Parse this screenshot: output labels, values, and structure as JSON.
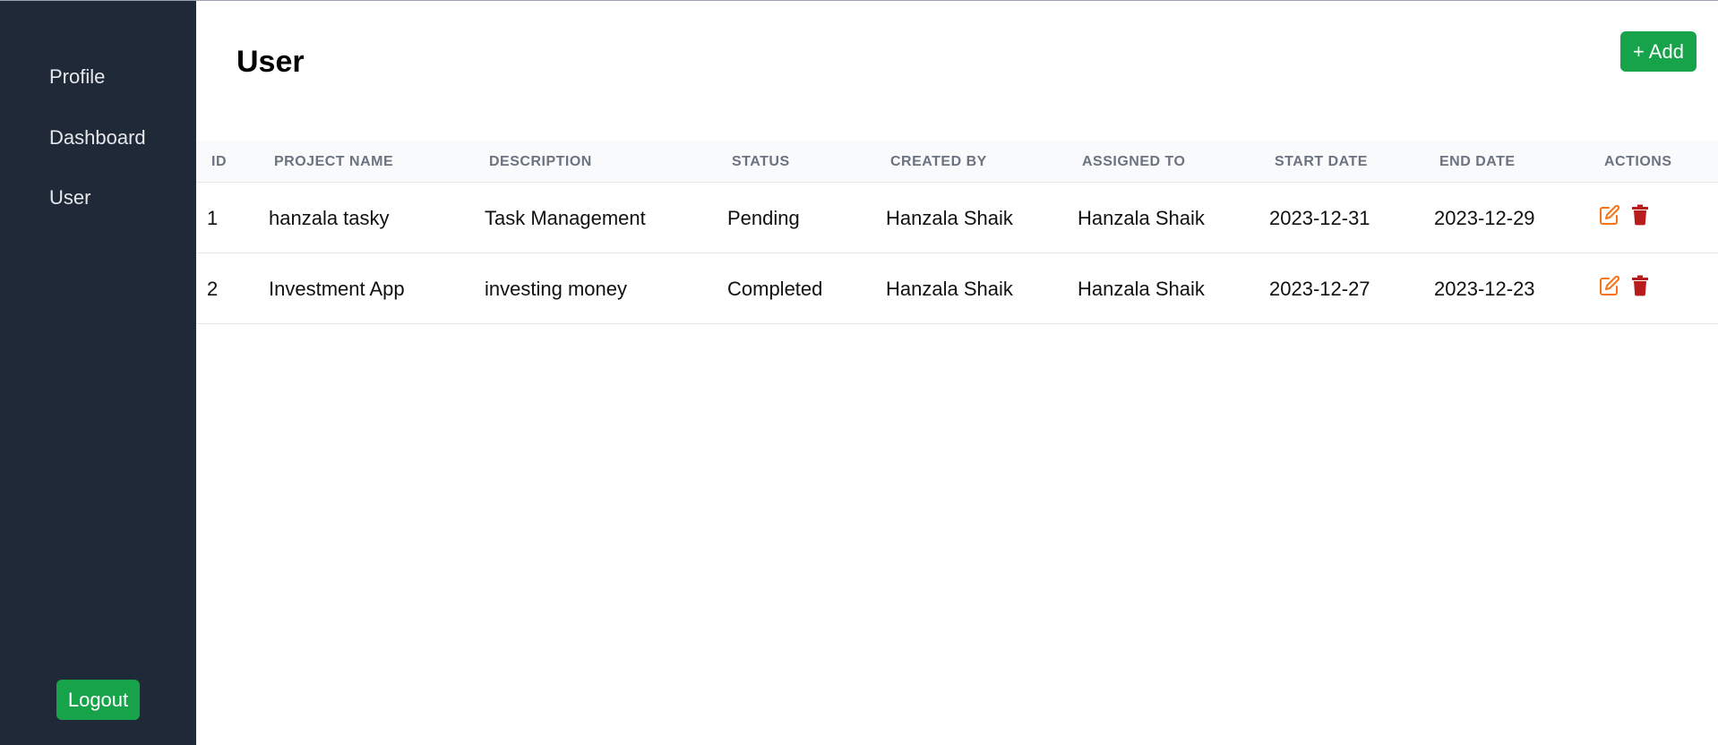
{
  "sidebar": {
    "items": [
      {
        "label": "Profile"
      },
      {
        "label": "Dashboard"
      },
      {
        "label": "User"
      }
    ],
    "logout_label": "Logout"
  },
  "header": {
    "title": "User",
    "add_label": "+ Add"
  },
  "table": {
    "columns": [
      "ID",
      "PROJECT NAME",
      "DESCRIPTION",
      "STATUS",
      "CREATED BY",
      "ASSIGNED TO",
      "START DATE",
      "END DATE",
      "ACTIONS"
    ],
    "rows": [
      {
        "id": "1",
        "project_name": "hanzala tasky",
        "description": "Task Management",
        "status": "Pending",
        "created_by": "Hanzala Shaik",
        "assigned_to": "Hanzala Shaik",
        "start_date": "2023-12-31",
        "end_date": "2023-12-29"
      },
      {
        "id": "2",
        "project_name": "Investment App",
        "description": "investing money",
        "status": "Completed",
        "created_by": "Hanzala Shaik",
        "assigned_to": "Hanzala Shaik",
        "start_date": "2023-12-27",
        "end_date": "2023-12-23"
      }
    ],
    "action_icons": [
      "edit-icon",
      "trash-icon"
    ]
  },
  "colors": {
    "sidebar_bg": "#1f2937",
    "accent_green": "#16a34a",
    "edit_orange": "#f97316",
    "delete_red": "#b91c1c",
    "header_text": "#6b7280"
  }
}
